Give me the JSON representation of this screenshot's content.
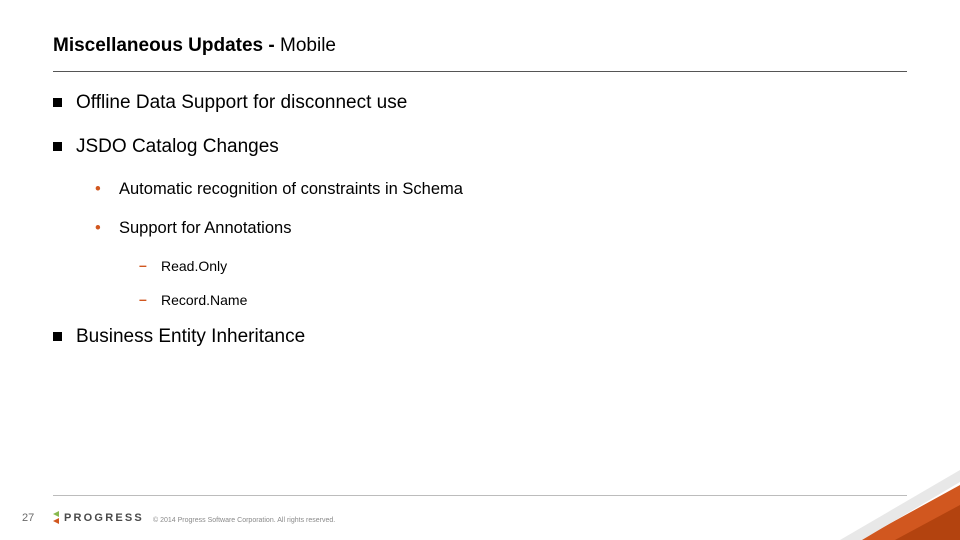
{
  "title": {
    "bold": "Miscellaneous Updates - ",
    "rest": "Mobile"
  },
  "bullets": {
    "l1_a": "Offline Data Support for disconnect use",
    "l1_b": "JSDO Catalog Changes",
    "l2_a": "Automatic recognition of constraints in Schema",
    "l2_b": "Support for Annotations",
    "l3_a": "Read.Only",
    "l3_b": "Record.Name",
    "l1_c": "Business Entity Inheritance"
  },
  "footer": {
    "page": "27",
    "logo_text": "PROGRESS",
    "copyright": "© 2014 Progress Software Corporation. All rights reserved."
  },
  "colors": {
    "accent": "#d1571f"
  }
}
